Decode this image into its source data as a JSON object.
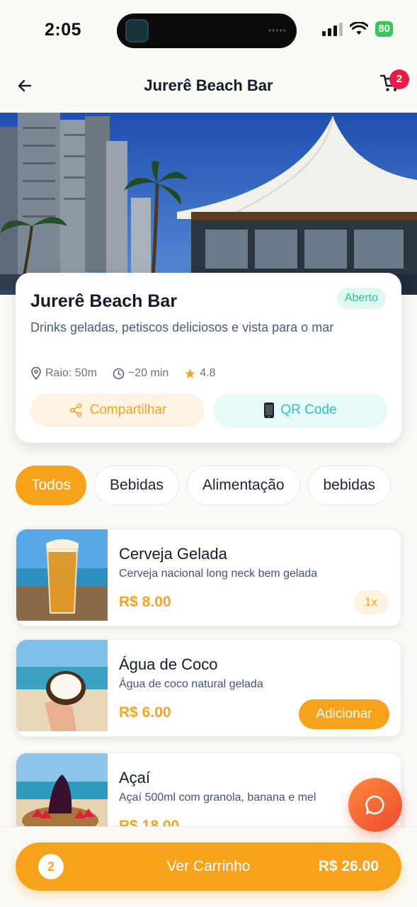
{
  "status_bar": {
    "time": "2:05",
    "battery": "80"
  },
  "header": {
    "title": "Jurerê Beach Bar",
    "cart_badge": "2"
  },
  "venue": {
    "name": "Jurerê Beach Bar",
    "status": "Aberto",
    "description": "Drinks geladas, petiscos deliciosos e vista para o mar",
    "radius": "Raio: 50m",
    "time": "~20 min",
    "rating": "4.8",
    "share_label": "Compartilhar",
    "qr_label": "QR Code"
  },
  "categories": [
    {
      "label": "Todos",
      "active": true
    },
    {
      "label": "Bebidas"
    },
    {
      "label": "Alimentação"
    },
    {
      "label": "bebidas"
    }
  ],
  "products": [
    {
      "name": "Cerveja Gelada",
      "description": "Cerveja nacional long neck bem gelada",
      "price": "R$ 8.00",
      "quantity": "1x"
    },
    {
      "name": "Água de Coco",
      "description": "Água de coco natural gelada",
      "price": "R$ 6.00",
      "action": "Adicionar"
    },
    {
      "name": "Açaí",
      "description": "Açaí 500ml com granola, banana e mel",
      "price": "R$ 18.00"
    }
  ],
  "cart_bar": {
    "count": "2",
    "label": "Ver Carrinho",
    "total": "R$ 26.00"
  },
  "colors": {
    "accent": "#f7a21b",
    "open": "#2bbfa4",
    "badge": "#e11d48"
  }
}
